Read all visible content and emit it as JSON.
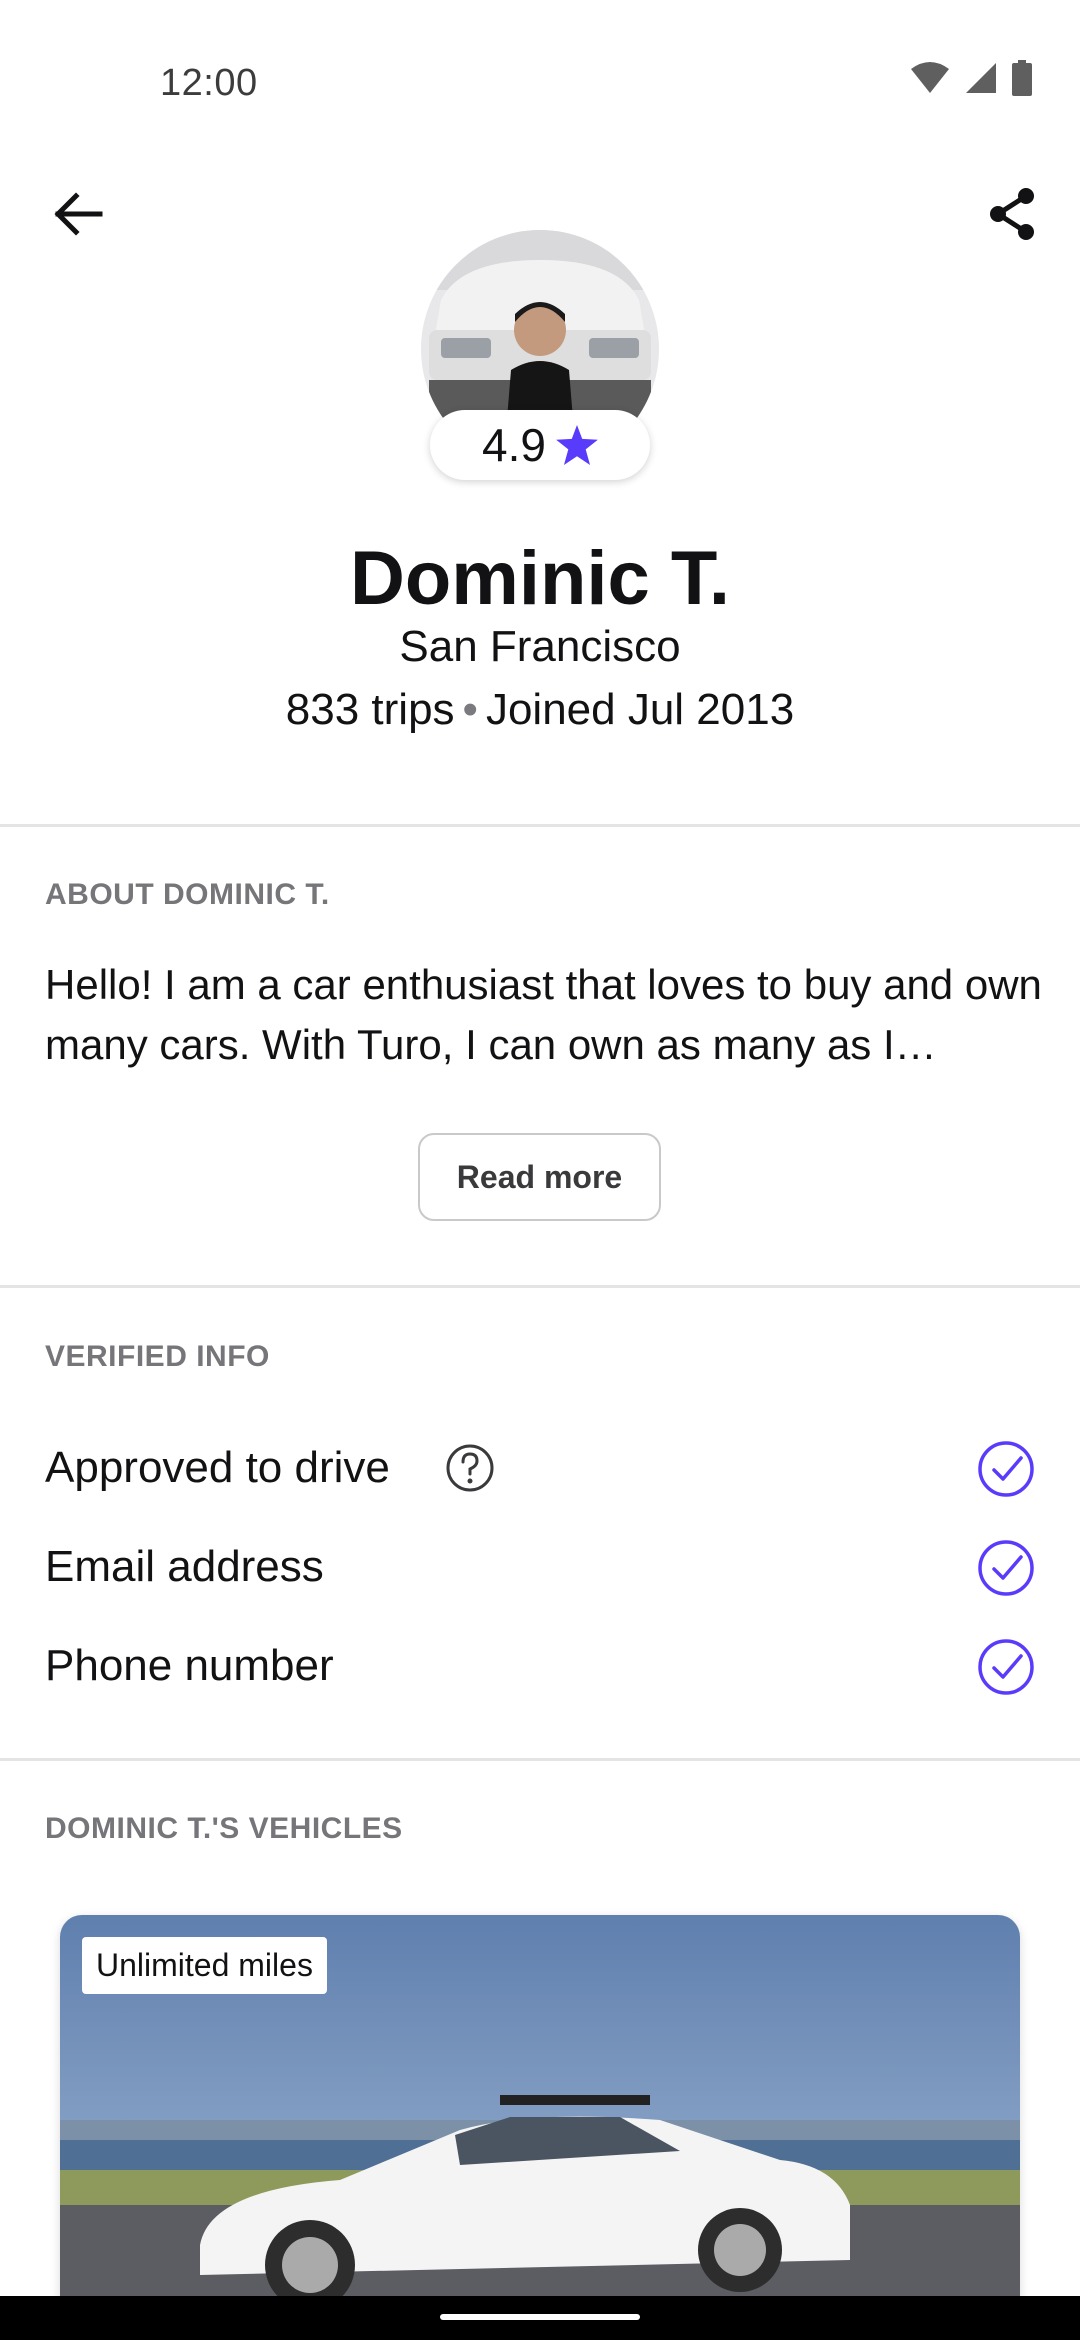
{
  "status": {
    "time": "12:00"
  },
  "host": {
    "rating": "4.9",
    "name": "Dominic T.",
    "location": "San Francisco",
    "trips": "833 trips",
    "separator": "•",
    "joined": "Joined Jul 2013"
  },
  "about": {
    "heading": "ABOUT DOMINIC T.",
    "text": "Hello! I am a car enthusiast that loves to buy and own many cars. With Turo, I can own as many as I…",
    "read_more_label": "Read more"
  },
  "verified": {
    "heading": "VERIFIED INFO",
    "items": [
      {
        "label": "Approved to drive"
      },
      {
        "label": "Email address"
      },
      {
        "label": "Phone number"
      }
    ]
  },
  "vehicles": {
    "heading": "DOMINIC T.'S VEHICLES",
    "cards": [
      {
        "badge": "Unlimited miles"
      }
    ]
  },
  "colors": {
    "accent": "#593CFB",
    "text": "#121214",
    "muted": "#76767A",
    "divider": "#E4E4E6"
  },
  "icons": {
    "back": "arrow-left-icon",
    "share": "share-icon",
    "star": "star-icon",
    "help": "question-circle-icon",
    "check": "check-circle-icon"
  }
}
